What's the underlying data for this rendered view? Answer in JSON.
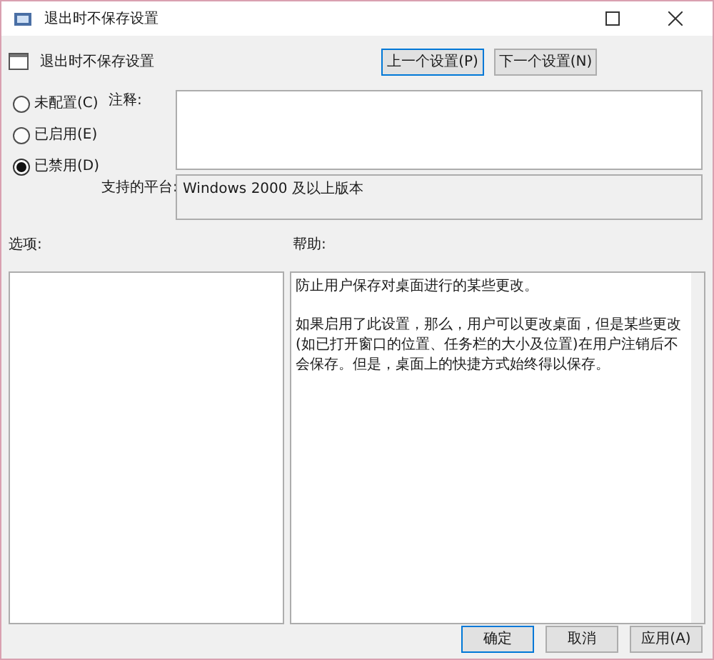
{
  "window": {
    "title": "退出时不保存设置"
  },
  "header": {
    "title": "退出时不保存设置",
    "buttons": [
      {
        "label": "上一个设置(P)",
        "focused": true
      },
      {
        "label": "下一个设置(N)",
        "focused": false
      }
    ]
  },
  "state_options": [
    {
      "label": "未配置(C)",
      "selected": false
    },
    {
      "label": "已启用(E)",
      "selected": false
    },
    {
      "label": "已禁用(D)",
      "selected": true
    }
  ],
  "comment": {
    "label": "注释:"
  },
  "platform": {
    "label": "支持的平台:",
    "value": "Windows 2000 及以上版本"
  },
  "options": {
    "label": "选项:"
  },
  "help": {
    "label": "帮助:",
    "paragraphs": [
      "防止用户保存对桌面进行的某些更改。",
      "如果启用了此设置，那么，用户可以更改桌面，但是某些更改(如已打开窗口的位置、任务栏的大小及位置)在用户注销后不会保存。但是，桌面上的快捷方式始终得以保存。"
    ]
  },
  "footer_buttons": [
    {
      "label": "确定",
      "focused": true
    },
    {
      "label": "取消",
      "focused": false
    },
    {
      "label": "应用(A)",
      "focused": false
    }
  ]
}
